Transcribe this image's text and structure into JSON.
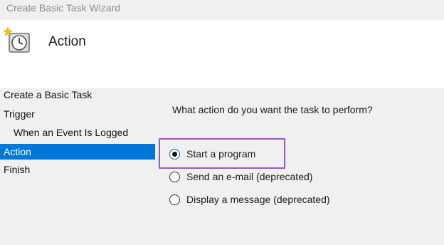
{
  "window": {
    "title": "Create Basic Task Wizard",
    "icon": "clock-icon"
  },
  "header": {
    "title": "Action"
  },
  "steps": [
    {
      "label": "Create a Basic Task",
      "active": false,
      "sub": false
    },
    {
      "label": "Trigger",
      "active": false,
      "sub": false
    },
    {
      "label": "When an Event Is Logged",
      "active": false,
      "sub": true
    },
    {
      "label": "Action",
      "active": true,
      "sub": false
    },
    {
      "label": "Finish",
      "active": false,
      "sub": false
    }
  ],
  "content": {
    "question": "What action do you want the task to perform?",
    "options": [
      {
        "label": "Start a program",
        "checked": true
      },
      {
        "label": "Send an e-mail (deprecated)",
        "checked": false
      },
      {
        "label": "Display a message (deprecated)",
        "checked": false
      }
    ]
  },
  "colors": {
    "selection": "#0078d7",
    "highlight_border": "#9b59c8"
  }
}
